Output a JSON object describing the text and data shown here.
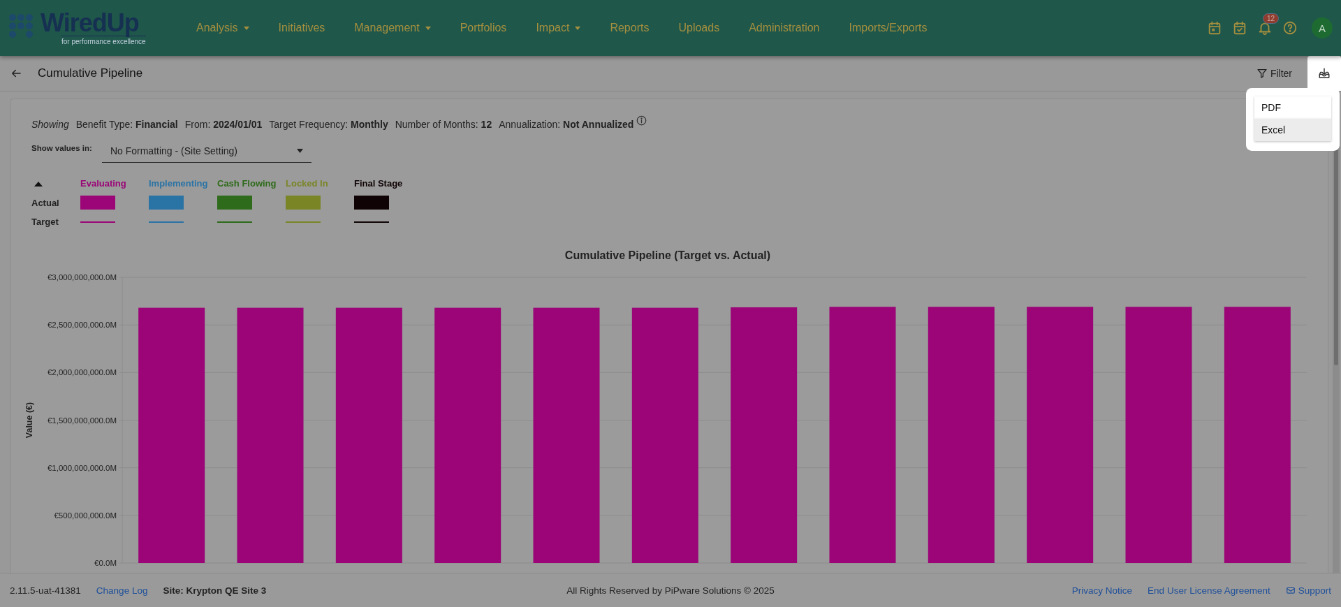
{
  "nav": {
    "logo": {
      "name": "WiredUp",
      "tagline": "for performance excellence"
    },
    "menu": [
      {
        "label": "Analysis",
        "dropdown": true
      },
      {
        "label": "Initiatives",
        "dropdown": false
      },
      {
        "label": "Management",
        "dropdown": true
      },
      {
        "label": "Portfolios",
        "dropdown": false
      },
      {
        "label": "Impact",
        "dropdown": true
      },
      {
        "label": "Reports",
        "dropdown": false
      },
      {
        "label": "Uploads",
        "dropdown": false
      },
      {
        "label": "Administration",
        "dropdown": false
      },
      {
        "label": "Imports/Exports",
        "dropdown": false
      }
    ],
    "notification_count": "12",
    "avatar": "A"
  },
  "header": {
    "title": "Cumulative Pipeline",
    "filter": "Filter",
    "export_menu": [
      {
        "label": "PDF",
        "selected": false
      },
      {
        "label": "Excel",
        "selected": true
      }
    ]
  },
  "report": {
    "showing": "Showing",
    "criteria": [
      {
        "label": "Benefit Type:",
        "value": "Financial"
      },
      {
        "label": "From:",
        "value": "2024/01/01"
      },
      {
        "label": "Target Frequency:",
        "value": "Monthly"
      },
      {
        "label": "Number of Months:",
        "value": "12"
      },
      {
        "label": "Annualization:",
        "value": "Not Annualized"
      }
    ],
    "show_values": {
      "label": "Show values in:",
      "value": "No Formatting - (Site Setting)"
    },
    "legend": {
      "expanded": true,
      "rows": [
        "Actual",
        "Target"
      ],
      "series": [
        {
          "name": "Evaluating",
          "color": "#9b0577"
        },
        {
          "name": "Implementing",
          "color": "#2a73a5"
        },
        {
          "name": "Cash Flowing",
          "color": "#2e6b1a"
        },
        {
          "name": "Locked In",
          "color": "#7a8526"
        },
        {
          "name": "Final Stage",
          "color": "#0f0305"
        }
      ]
    },
    "chart_data": {
      "type": "bar",
      "title": "Cumulative Pipeline (Target vs. Actual)",
      "ylabel": "Value  (€)",
      "ylim": [
        0,
        3000000000
      ],
      "yticks": [
        {
          "value": 0,
          "label": "€0.0M"
        },
        {
          "value": 500000000,
          "label": "€500,000,000.0M"
        },
        {
          "value": 1000000000,
          "label": "€1,000,000,000.0M"
        },
        {
          "value": 1500000000,
          "label": "€1,500,000,000.0M"
        },
        {
          "value": 2000000000,
          "label": "€2,000,000,000.0M"
        },
        {
          "value": 2500000000,
          "label": "€2,500,000,000.0M"
        },
        {
          "value": 3000000000,
          "label": "€3,000,000,000.0M"
        }
      ],
      "grid": true,
      "series": [
        {
          "color": "#9b0577",
          "values": [
            2680000000,
            2680000000,
            2680000000,
            2680000000,
            2680000000,
            2680000000,
            2685000000,
            2690000000,
            2690000000,
            2690000000,
            2690000000,
            2690000000
          ]
        }
      ]
    }
  },
  "footer": {
    "version": "2.11.5-uat-41381",
    "change_log": "Change Log",
    "site": "Site: Krypton QE Site 3",
    "copyright": "All Rights Reserved by PiPware Solutions © 2025",
    "links": [
      "Privacy Notice",
      "End User License Agreement"
    ],
    "support": "Support"
  }
}
